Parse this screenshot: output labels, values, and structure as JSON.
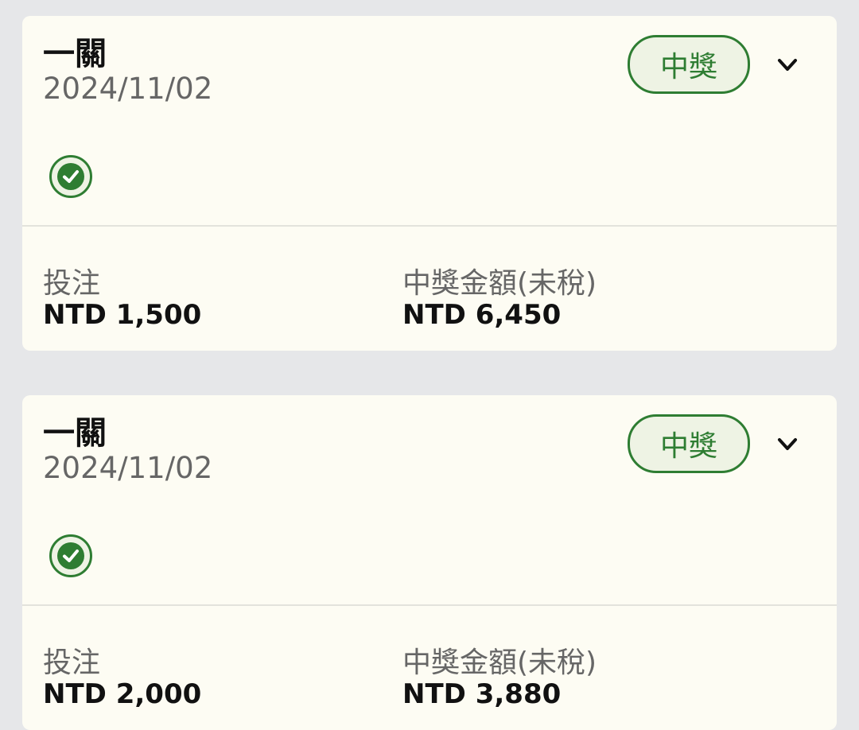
{
  "colors": {
    "page_background": "#e6e7e9",
    "card_background": "#fdfcf3",
    "accent_green": "#2e7d32",
    "badge_fill": "#eef3e4"
  },
  "cards": [
    {
      "title": "一關",
      "date": "2024/11/02",
      "status_badge": "中獎",
      "expand_icon": "chevron-down-icon",
      "check_icon": "check-circle-icon",
      "bet_label": "投注",
      "bet_value": "NTD 1,500",
      "prize_label": "中獎金額(未稅)",
      "prize_value": "NTD 6,450"
    },
    {
      "title": "一關",
      "date": "2024/11/02",
      "status_badge": "中獎",
      "expand_icon": "chevron-down-icon",
      "check_icon": "check-circle-icon",
      "bet_label": "投注",
      "bet_value": "NTD 2,000",
      "prize_label": "中獎金額(未稅)",
      "prize_value": "NTD 3,880"
    }
  ]
}
